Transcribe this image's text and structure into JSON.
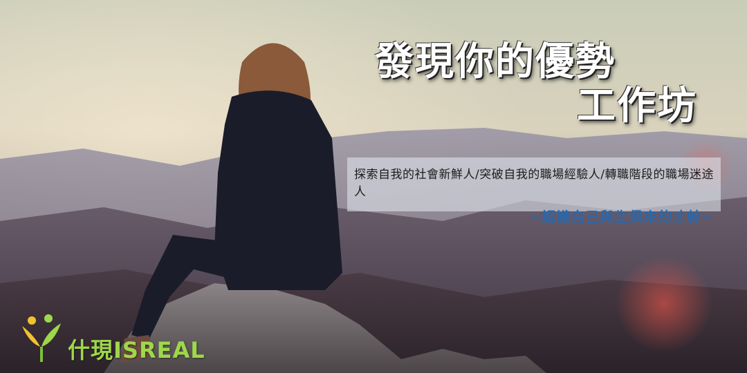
{
  "banner": {
    "title_line_1": "發現你的優勢",
    "title_line_2": "工作坊",
    "subtitle_line_1": "探索自我的社會新鮮人/突破自我的職場經驗人/轉職階段的職場迷途人",
    "subtitle_line_2": "~認識自己與生俱來的才幹~"
  },
  "brand": {
    "name": "什現ISREAL",
    "logo_icon": "green-sprout-person-icon",
    "brand_color": "#9ed84a"
  },
  "colors": {
    "subtitle_accent": "#2b67a8",
    "title_text": "#ffffff"
  }
}
